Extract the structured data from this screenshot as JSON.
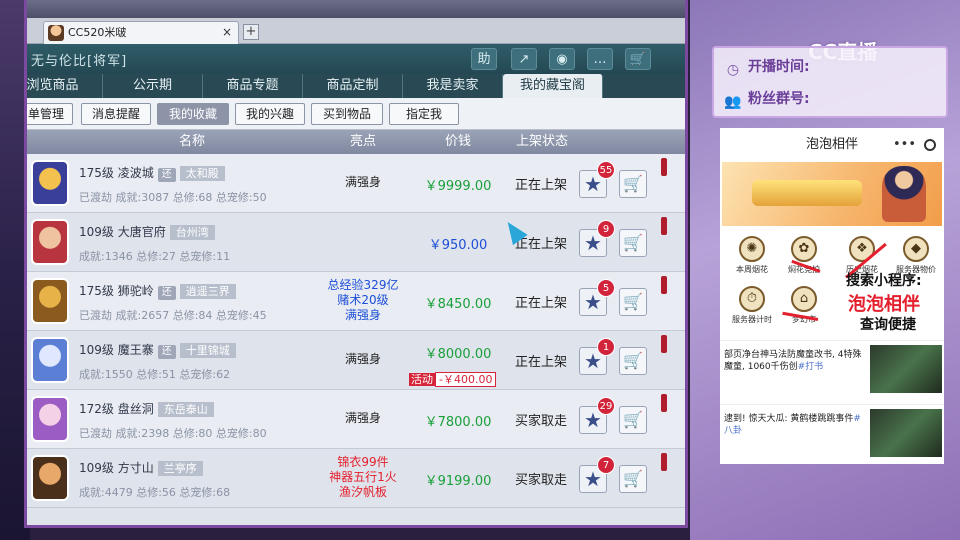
{
  "browser": {
    "tab_title": "CC520米啵",
    "tab_close": "×",
    "tab_add": "+"
  },
  "header": {
    "title": "无与伦比[将军]",
    "tools": [
      {
        "label": "助",
        "icon": "help-icon"
      },
      {
        "label": "↗",
        "icon": "share-icon"
      },
      {
        "label": "◉",
        "icon": "record-icon"
      },
      {
        "label": "…",
        "icon": "chat-icon"
      },
      {
        "label": "🛒",
        "icon": "cart-icon"
      }
    ]
  },
  "nav": [
    {
      "label": "浏览商品"
    },
    {
      "label": "公示期"
    },
    {
      "label": "商品专题"
    },
    {
      "label": "商品定制"
    },
    {
      "label": "我是卖家"
    },
    {
      "label": "我的藏宝阁",
      "active": true
    }
  ],
  "subnav": [
    {
      "label": "单管理"
    },
    {
      "label": "消息提醒"
    },
    {
      "label": "我的收藏",
      "active": true
    },
    {
      "label": "我的兴趣"
    },
    {
      "label": "买到物品"
    },
    {
      "label": "指定我"
    }
  ],
  "table": {
    "headers": {
      "name": "名称",
      "highlight": "亮点",
      "price": "价钱",
      "status": "上架状态"
    },
    "rows": [
      {
        "level_server": "175级 凌波城",
        "tag": "还",
        "region": "太和殿",
        "info": "已渡劫 成就:3087 总修:68 总宠修:50",
        "highlight": [
          "满强身"
        ],
        "hl_color": "#222",
        "price": "￥9999.00",
        "price_color": "#19a03a",
        "status": "正在上架",
        "favs": "55",
        "avatar": [
          "#3a3f9a",
          "#f2c14e"
        ]
      },
      {
        "level_server": "109级 大唐官府",
        "tag": "",
        "region": "台州湾",
        "info": "成就:1346 总修:27 总宠修:11",
        "highlight": [],
        "hl_color": "#222",
        "price": "￥950.00",
        "price_color": "#1d4fd8",
        "status": "正在上架",
        "favs": "9",
        "avatar": [
          "#b8343f",
          "#f0c3a0"
        ]
      },
      {
        "level_server": "175级 狮驼岭",
        "tag": "还",
        "region": "逍遥三界",
        "info": "已渡劫 成就:2657 总修:84 总宠修:45",
        "highlight": [
          "总经验329亿",
          "赌术20级",
          "满强身"
        ],
        "hl_color": "#1d4fd8",
        "price": "￥8450.00",
        "price_color": "#19a03a",
        "status": "正在上架",
        "favs": "5",
        "avatar": [
          "#8a5a1f",
          "#e7b348"
        ]
      },
      {
        "level_server": "109级 魔王寨",
        "tag": "还",
        "region": "十里锦城",
        "info": "成就:1550 总修:51 总宠修:62",
        "highlight": [
          "满强身"
        ],
        "hl_color": "#222",
        "price": "￥8000.00",
        "price_color": "#19a03a",
        "promo_tag": "活动",
        "promo_val": "-￥400.00",
        "status": "正在上架",
        "favs": "1",
        "avatar": [
          "#5c7fd6",
          "#dfe8ff"
        ]
      },
      {
        "level_server": "172级 盘丝洞",
        "tag": "",
        "region": "东岳泰山",
        "info": "已渡劫 成就:2398 总修:80 总宠修:80",
        "highlight": [
          "满强身"
        ],
        "hl_color": "#222",
        "price": "￥7800.00",
        "price_color": "#19a03a",
        "status": "买家取走",
        "favs": "29",
        "avatar": [
          "#9b5cc4",
          "#f4d1e6"
        ]
      },
      {
        "level_server": "109级 方寸山",
        "tag": "",
        "region": "兰亭序",
        "info": "成就:4479 总修:56 总宠修:68",
        "highlight": [
          "锦衣99件",
          "神器五行1火",
          "渔汐帆板"
        ],
        "hl_color": "#e4202e",
        "price": "￥9199.00",
        "price_color": "#19a03a",
        "status": "买家取走",
        "favs": "7",
        "avatar": [
          "#4a2f1a",
          "#e7a86a"
        ]
      }
    ]
  },
  "stream": {
    "logo": "CC直播",
    "start_time_label": "开播时间:",
    "fans_group_label": "粉丝群号:"
  },
  "miniapp": {
    "title": "泡泡相伴",
    "dots": "•••",
    "icons": [
      {
        "label": "本周烟花"
      },
      {
        "label": "焖花竞拍"
      },
      {
        "label": "历史烟花"
      },
      {
        "label": "服务器物价"
      },
      {
        "label": "服务器计时"
      },
      {
        "label": "梦幻市"
      }
    ],
    "ad_line1": "搜索小程序:",
    "ad_line2": "泡泡相伴",
    "ad_line3": "查询便捷",
    "news": [
      {
        "text": "部页净台神马法防魔童改书, 4特殊魔童, 1060千伤创",
        "tag": "#打书"
      },
      {
        "text": "逮到! 惊天大瓜: 黄鹤楼跳跳事件",
        "tag": "#八卦"
      }
    ]
  },
  "colors": {
    "accent": "#7b4aa0",
    "nav_bg": "#294a55",
    "badge": "#d2233a"
  }
}
